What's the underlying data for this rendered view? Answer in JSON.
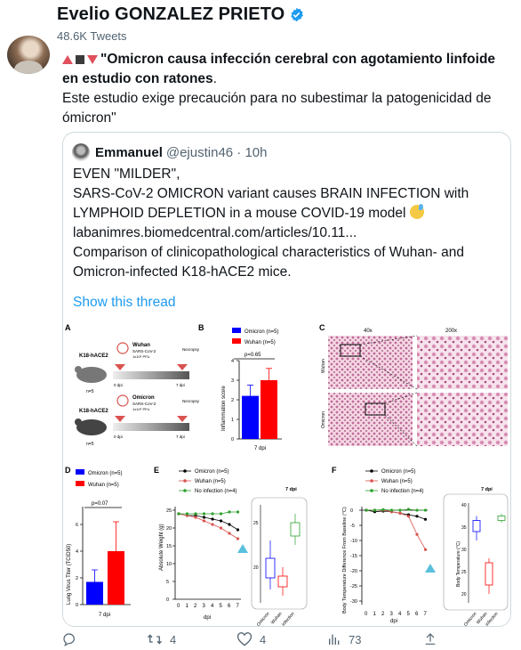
{
  "header": {
    "name": "Evelio GONZALEZ PRIETO",
    "tweet_count": "48.6K Tweets"
  },
  "tweet": {
    "title_bold": "\"Omicron causa infección cerebral con agotamiento linfoide en estudio con ratones",
    "title_end": ".",
    "body": "Este estudio exige precaución para no subestimar la patogenicidad de ómicron\""
  },
  "quote": {
    "name": "Emmanuel",
    "meta": "@ejustin46 · 10h",
    "lines": [
      "EVEN \"MILDER\",",
      "SARS-CoV-2 OMICRON variant causes BRAIN INFECTION with",
      "LYMPHOID DEPLETION in a mouse COVID-19 model",
      "labanimres.biomedcentral.com/articles/10.11...",
      "",
      "Comparison of clinicopathological characteristics of Wuhan- and",
      "Omicron-infected K18-hACE2 mice."
    ],
    "show_thread": "Show this thread"
  },
  "figure": {
    "panel_a": {
      "letter": "A",
      "mouse_label": "K18-hACE2",
      "n": "n=5",
      "wuhan": "Wuhan",
      "omicron": "Omicron",
      "virus": "SARS-CoV-2",
      "dose": "1x10⁵ PFU",
      "day0": "0 dpi",
      "day7": "7 dpi",
      "necropsy": "Necropsy"
    },
    "panel_b": {
      "letter": "B",
      "legend_omicron": "Omicron (n=5)",
      "legend_wuhan": "Wuhan (n=5)",
      "pval": "p=0.65",
      "ylabel": "Inflammation score",
      "xlabel": "7 dpi",
      "ticks": [
        "0",
        "1",
        "2",
        "3",
        "4"
      ]
    },
    "panel_c": {
      "letter": "C",
      "mag1": "40x",
      "mag2": "200x",
      "row1": "Wuhan",
      "row2": "Omicron"
    },
    "panel_d": {
      "letter": "D",
      "legend_omicron": "Omicron (n=5)",
      "legend_wuhan": "Wuhan (n=5)",
      "pval": "p=0.07",
      "ylabel": "Lung Virus Titer (TCID50)",
      "xlabel": "7 dpi",
      "ticks": [
        "0",
        "2",
        "4",
        "6"
      ]
    },
    "panel_e": {
      "letter": "E",
      "legend": [
        "Omicron (n=5)",
        "Wuhan (n=5)",
        "No infection (n=4)"
      ],
      "ylabel": "Absolute Weight (g)",
      "xlabel": "dpi",
      "yticks": [
        "0",
        "5",
        "10",
        "15",
        "20",
        "25"
      ],
      "xticks": [
        "0",
        "1",
        "2",
        "3",
        "4",
        "5",
        "6",
        "7"
      ],
      "inset_title": "7 dpi",
      "inset_ticks": [
        "20",
        "25"
      ],
      "inset_x": [
        "Omicron",
        "Wuhan",
        "No infection"
      ]
    },
    "panel_f": {
      "letter": "F",
      "legend": [
        "Omicron (n=5)",
        "Wuhan (n=5)",
        "No infection (n=4)"
      ],
      "ylabel": "Body Temperature Difference From Baseline (°C)",
      "ylabel2": "Body Temperature (°C)",
      "xlabel": "dpi",
      "yticks": [
        "0",
        "-5",
        "-10",
        "-15",
        "-20",
        "-25",
        "-30"
      ],
      "xticks": [
        "0",
        "1",
        "2",
        "3",
        "4",
        "5",
        "6",
        "7"
      ],
      "inset_title": "7 dpi",
      "inset_ticks": [
        "20",
        "25",
        "30",
        "35",
        "40"
      ],
      "inset_x": [
        "Omicron",
        "Wuhan",
        "No infection"
      ]
    },
    "colors": {
      "omicron": "#0000ff",
      "wuhan": "#ff0000",
      "no_infection": "#2ca02c"
    }
  },
  "actions": {
    "replies": "",
    "retweets": "4",
    "likes": "4",
    "views": "73"
  }
}
